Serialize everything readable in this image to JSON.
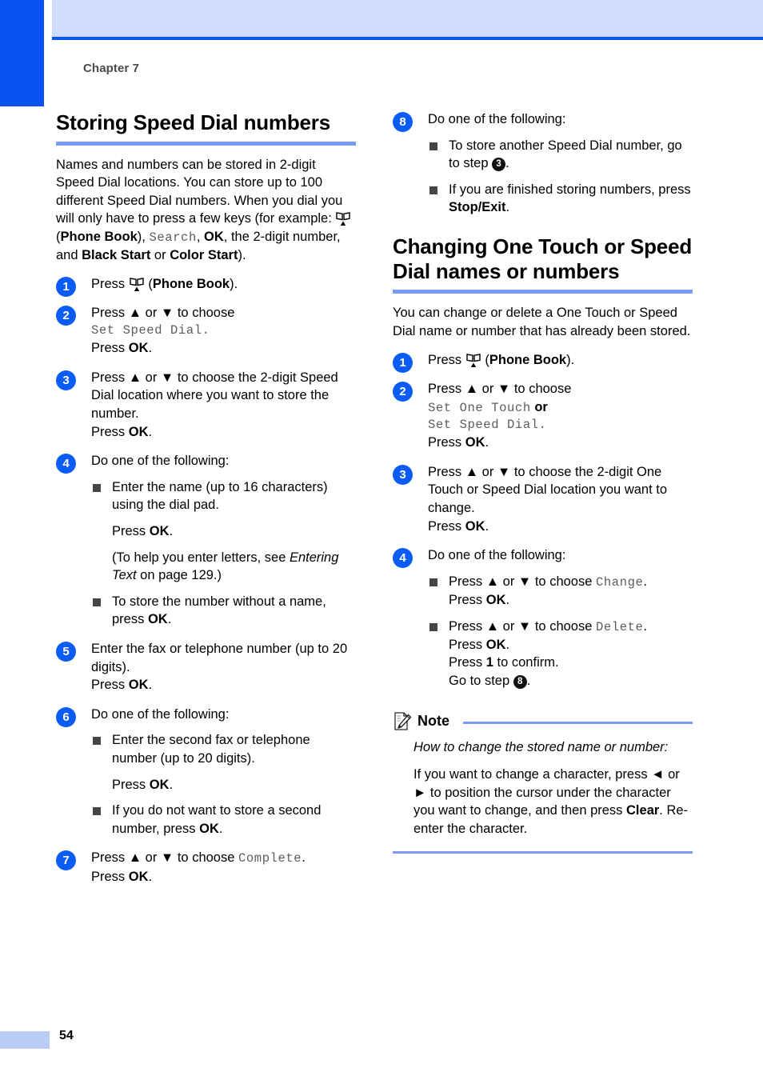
{
  "page": {
    "chapter_label": "Chapter 7",
    "page_number": "54",
    "accent_blue": "#0b52f5",
    "rule_blue": "#7b9bfb",
    "header_band_blue": "#cfdcfb"
  },
  "left_column": {
    "title": "Storing Speed Dial numbers",
    "intro": {
      "line1": "Names and numbers can be stored in 2-digit Speed Dial locations. You can store up to 100 different Speed Dial numbers. When you dial you will only have to press a few keys (for example: ",
      "icon": "phone-book-icon",
      "after_icon": " (",
      "phone_book_bold": "Phone Book",
      "after_pb": "), ",
      "search_lcd": "Search",
      "comma": ", ",
      "ok_bold": "OK",
      "tail1": ", the 2-digit number, and ",
      "black_start_bold": "Black Start",
      "or_text": " or ",
      "color_start_bold": "Color Start",
      "tail2": ")."
    },
    "steps": [
      {
        "number": "1",
        "press_word": "Press ",
        "icon": "phone-book-icon",
        "after_icon": " (",
        "bold": "Phone Book",
        "tail": ")."
      },
      {
        "number": "2",
        "line1": "Press ▲ or ▼ to choose",
        "lcd": "Set Speed Dial.",
        "press_ok_prefix": "Press ",
        "press_ok_bold": "OK",
        "press_ok_suffix": "."
      },
      {
        "number": "3",
        "line1": "Press ▲ or ▼ to choose the 2-digit Speed Dial location where you want to store the number.",
        "press_ok_prefix": "Press ",
        "press_ok_bold": "OK",
        "press_ok_suffix": "."
      },
      {
        "number": "4",
        "line1": "Do one of the following:",
        "bullets": [
          {
            "text": "Enter the name (up to 16 characters) using the dial pad.",
            "sub_paras": [
              {
                "prefix": "Press ",
                "bold": "OK",
                "suffix": "."
              },
              {
                "prefix": " (To help you enter letters, see ",
                "italic": "Entering Text",
                "suffix": " on page 129.)"
              }
            ]
          },
          {
            "prefix": "To store the number without a name, press ",
            "bold": "OK",
            "suffix": "."
          }
        ]
      },
      {
        "number": "5",
        "line1": "Enter the fax or telephone number (up to 20 digits).",
        "press_ok_prefix": "Press ",
        "press_ok_bold": "OK",
        "press_ok_suffix": "."
      },
      {
        "number": "6",
        "line1": "Do one of the following:",
        "bullets": [
          {
            "text": "Enter the second fax or telephone number (up to 20 digits).",
            "sub_paras": [
              {
                "prefix": "Press ",
                "bold": "OK",
                "suffix": "."
              }
            ]
          },
          {
            "prefix": "If you do not want to store a second number, press ",
            "bold": "OK",
            "suffix": "."
          }
        ]
      },
      {
        "number": "7",
        "line1_prefix": "Press ▲ or ▼ to choose ",
        "line1_lcd": "Complete",
        "line1_suffix": ".",
        "press_ok_prefix": "Press ",
        "press_ok_bold": "OK",
        "press_ok_suffix": "."
      }
    ]
  },
  "right_column": {
    "step8": {
      "number": "8",
      "line1": "Do one of the following:",
      "bullets": [
        {
          "prefix": "To store another Speed Dial number, go to step ",
          "step_ref": "3",
          "suffix": "."
        },
        {
          "prefix": "If you are finished storing numbers, press ",
          "bold": "Stop/Exit",
          "suffix": "."
        }
      ]
    },
    "title": "Changing One Touch or Speed Dial names or numbers",
    "intro": "You can change or delete a One Touch or Speed Dial name or number that has already been stored.",
    "steps": [
      {
        "number": "1",
        "press_word": "Press ",
        "icon": "phone-book-icon",
        "after_icon": " (",
        "bold": "Phone Book",
        "tail": ")."
      },
      {
        "number": "2",
        "line1": "Press ▲ or ▼ to choose",
        "lcd1": "Set One Touch",
        "or_word": " or",
        "lcd2": "Set Speed Dial.",
        "press_ok_prefix": "Press ",
        "press_ok_bold": "OK",
        "press_ok_suffix": "."
      },
      {
        "number": "3",
        "line1": "Press ▲ or ▼ to choose the 2-digit One Touch or Speed Dial location you want to change.",
        "press_ok_prefix": "Press ",
        "press_ok_bold": "OK",
        "press_ok_suffix": "."
      },
      {
        "number": "4",
        "line1": "Do one of the following:",
        "bullets": [
          {
            "prefix": "Press ▲ or ▼ to choose ",
            "lcd": "Change",
            "suffix": ".",
            "lines": [
              {
                "prefix": "Press ",
                "bold": "OK",
                "suffix": "."
              }
            ]
          },
          {
            "prefix": "Press ▲ or ▼ to choose ",
            "lcd": "Delete",
            "suffix": ".",
            "lines": [
              {
                "prefix": "Press ",
                "bold": "OK",
                "suffix": "."
              },
              {
                "prefix": "Press ",
                "bold": "1",
                "suffix": " to confirm."
              },
              {
                "prefix": "Go to step ",
                "step_ref": "8",
                "suffix": "."
              }
            ]
          }
        ]
      }
    ],
    "note": {
      "icon": "note-pencil-icon",
      "label": "Note",
      "italic_line": "How to change the stored name or number:",
      "body_prefix": "If you want to change a character, press ◄ or ► to position the cursor under the character you want to change, and then press ",
      "body_bold": "Clear",
      "body_suffix": ". Re-enter the character."
    }
  }
}
